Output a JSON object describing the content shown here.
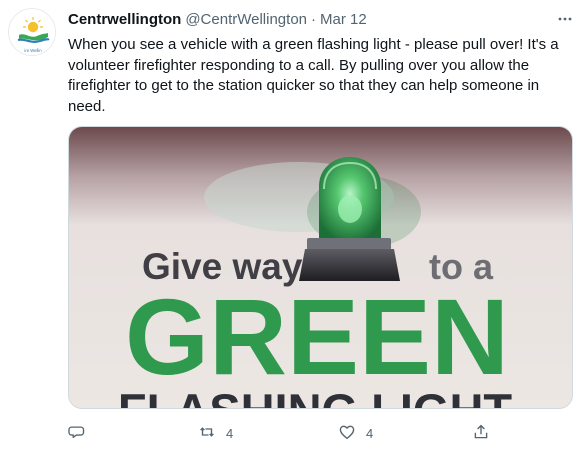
{
  "tweet": {
    "display_name": "Centrwellington",
    "handle": "@CentrWellington",
    "separator": "·",
    "date": "Mar 12",
    "text": "When you see a vehicle with a green flashing light - please pull over! It's a volunteer firefighter responding to a call. By pulling over you allow the firefighter to get to the station quicker so that they can help someone in need.",
    "avatar_text": "ire Wellin"
  },
  "media": {
    "line1_left": "Give way",
    "line1_right": "to a",
    "line2": "GREEN",
    "line3": "FLASHING LIGHT"
  },
  "actions": {
    "reply_icon": "reply-icon",
    "retweet_icon": "retweet-icon",
    "retweet_count": "4",
    "like_icon": "heart-icon",
    "like_count": "4",
    "share_icon": "share-icon",
    "more_icon": "more-horizontal-icon"
  },
  "colors": {
    "text": "#0f1419",
    "muted": "#536471",
    "green": "#2f9a4d",
    "light_green": "#6ad487"
  }
}
